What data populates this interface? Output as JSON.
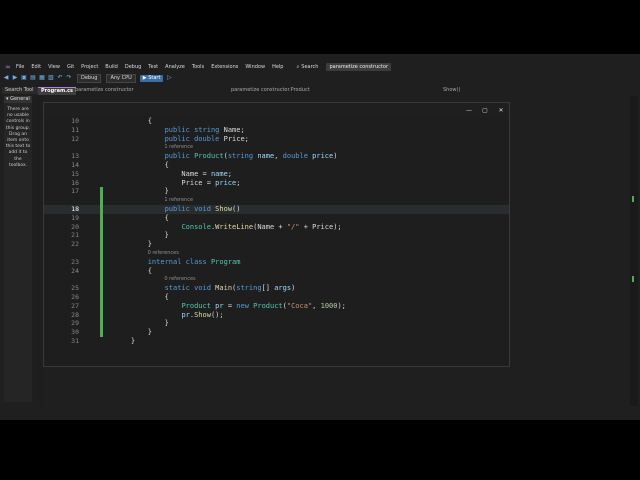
{
  "menu": {
    "items": [
      "File",
      "Edit",
      "View",
      "Git",
      "Project",
      "Build",
      "Debug",
      "Test",
      "Analyze",
      "Tools",
      "Extensions",
      "Window",
      "Help"
    ],
    "search_label": "Search",
    "solution_name": "parametize constructor"
  },
  "toolbar": {
    "config": "Debug",
    "platform": "Any CPU",
    "start_label": "Start"
  },
  "toolbox": {
    "tab_label": "Search Tool",
    "section": "General",
    "message": "There are no usable controls in this group. Drag an item onto this text to add it to the toolbox."
  },
  "tabs": {
    "active": "Program.cs",
    "context": "parametize constructor",
    "context2": "parametize constructor.Product",
    "member": "Show()"
  },
  "code": [
    {
      "n": "10",
      "tokens": [
        [
          "pl",
          "        {"
        ]
      ]
    },
    {
      "n": "11",
      "tokens": [
        [
          "pl",
          "            "
        ],
        [
          "kw",
          "public"
        ],
        [
          "pl",
          " "
        ],
        [
          "kw",
          "string"
        ],
        [
          "pl",
          " Name;"
        ]
      ]
    },
    {
      "n": "12",
      "tokens": [
        [
          "pl",
          "            "
        ],
        [
          "kw",
          "public"
        ],
        [
          "pl",
          " "
        ],
        [
          "kw",
          "double"
        ],
        [
          "pl",
          " Price;"
        ]
      ]
    },
    {
      "ref": "1 reference",
      "indent": "            "
    },
    {
      "n": "13",
      "tokens": [
        [
          "pl",
          "            "
        ],
        [
          "kw",
          "public"
        ],
        [
          "pl",
          " "
        ],
        [
          "ty",
          "Product"
        ],
        [
          "pl",
          "("
        ],
        [
          "kw",
          "string"
        ],
        [
          "pl",
          " "
        ],
        [
          "vr",
          "name"
        ],
        [
          "pl",
          ", "
        ],
        [
          "kw",
          "double"
        ],
        [
          "pl",
          " "
        ],
        [
          "vr",
          "price"
        ],
        [
          "pl",
          ")"
        ]
      ]
    },
    {
      "n": "14",
      "tokens": [
        [
          "pl",
          "            {"
        ]
      ]
    },
    {
      "n": "15",
      "tokens": [
        [
          "pl",
          "                Name = "
        ],
        [
          "vr",
          "name"
        ],
        [
          "pl",
          ";"
        ]
      ]
    },
    {
      "n": "16",
      "tokens": [
        [
          "pl",
          "                Price = "
        ],
        [
          "vr",
          "price"
        ],
        [
          "pl",
          ";"
        ]
      ]
    },
    {
      "n": "17",
      "tokens": [
        [
          "pl",
          "            }"
        ]
      ]
    },
    {
      "ref": "1 reference",
      "indent": "            "
    },
    {
      "n": "18",
      "current": true,
      "tokens": [
        [
          "pl",
          "            "
        ],
        [
          "kw",
          "public"
        ],
        [
          "pl",
          " "
        ],
        [
          "kw",
          "void"
        ],
        [
          "pl",
          " "
        ],
        [
          "fn",
          "Show"
        ],
        [
          "pl",
          "()"
        ]
      ]
    },
    {
      "n": "19",
      "tokens": [
        [
          "pl",
          "            {"
        ]
      ]
    },
    {
      "n": "20",
      "tokens": [
        [
          "pl",
          "                "
        ],
        [
          "ty",
          "Console"
        ],
        [
          "pl",
          "."
        ],
        [
          "fn",
          "WriteLine"
        ],
        [
          "pl",
          "(Name + "
        ],
        [
          "str",
          "\"/\""
        ],
        [
          "pl",
          " + Price);"
        ]
      ]
    },
    {
      "n": "21",
      "tokens": [
        [
          "pl",
          "            }"
        ]
      ]
    },
    {
      "n": "22",
      "tokens": [
        [
          "pl",
          "        }"
        ]
      ]
    },
    {
      "ref": "0 references",
      "indent": "        "
    },
    {
      "n": "23",
      "tokens": [
        [
          "pl",
          "        "
        ],
        [
          "kw",
          "internal"
        ],
        [
          "pl",
          " "
        ],
        [
          "kw",
          "class"
        ],
        [
          "pl",
          " "
        ],
        [
          "ty",
          "Program"
        ]
      ]
    },
    {
      "n": "24",
      "tokens": [
        [
          "pl",
          "        {"
        ]
      ]
    },
    {
      "ref": "0 references",
      "indent": "            "
    },
    {
      "n": "25",
      "tokens": [
        [
          "pl",
          "            "
        ],
        [
          "kw",
          "static"
        ],
        [
          "pl",
          " "
        ],
        [
          "kw",
          "void"
        ],
        [
          "pl",
          " "
        ],
        [
          "fn",
          "Main"
        ],
        [
          "pl",
          "("
        ],
        [
          "kw",
          "string"
        ],
        [
          "pl",
          "[] "
        ],
        [
          "vr",
          "args"
        ],
        [
          "pl",
          ")"
        ]
      ]
    },
    {
      "n": "26",
      "tokens": [
        [
          "pl",
          "            {"
        ]
      ]
    },
    {
      "n": "27",
      "tokens": [
        [
          "pl",
          "                "
        ],
        [
          "ty",
          "Product"
        ],
        [
          "pl",
          " "
        ],
        [
          "vr",
          "pr"
        ],
        [
          "pl",
          " = "
        ],
        [
          "kw",
          "new"
        ],
        [
          "pl",
          " "
        ],
        [
          "ty",
          "Product"
        ],
        [
          "pl",
          "("
        ],
        [
          "str",
          "\"Coca\""
        ],
        [
          "pl",
          ", "
        ],
        [
          "num",
          "1000"
        ],
        [
          "pl",
          ");"
        ]
      ]
    },
    {
      "n": "28",
      "tokens": [
        [
          "pl",
          "                "
        ],
        [
          "vr",
          "pr"
        ],
        [
          "pl",
          "."
        ],
        [
          "fn",
          "Show"
        ],
        [
          "pl",
          "();"
        ]
      ]
    },
    {
      "n": "29",
      "tokens": [
        [
          "pl",
          "            }"
        ]
      ]
    },
    {
      "n": "30",
      "tokens": [
        [
          "pl",
          "        }"
        ]
      ]
    },
    {
      "n": "31",
      "tokens": [
        [
          "pl",
          "    }"
        ]
      ]
    }
  ]
}
